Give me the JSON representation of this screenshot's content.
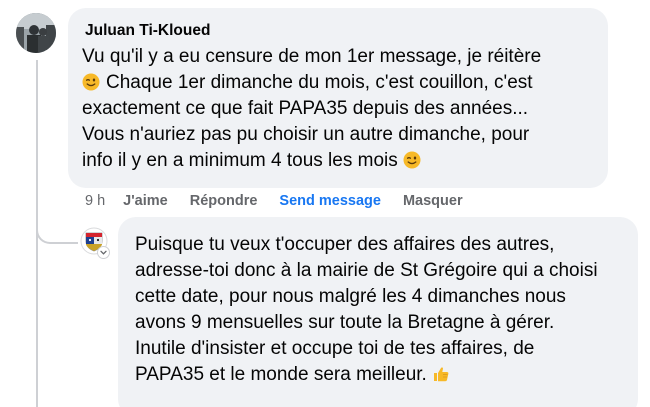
{
  "comment1": {
    "author": "Juluan Ti-Kloued",
    "lines": [
      "Vu qu'il y a eu censure de mon 1er message, je réitère",
      "Chaque 1er dimanche du mois, c'est couillon, c'est",
      "exactement ce que fait PAPA35 depuis des années...",
      "Vous n'auriez pas pu choisir un autre dimanche, pour",
      "info il y en a minimum 4 tous les mois"
    ],
    "emojis": [
      "winking-face-emoji",
      "winking-face-emoji"
    ],
    "actions": {
      "time": "9 h",
      "like": "J'aime",
      "reply": "Répondre",
      "send_message": "Send message",
      "hide": "Masquer"
    }
  },
  "reply1": {
    "lines": [
      "Puisque tu veux t'occuper des affaires des autres,",
      "adresse-toi donc à la mairie de St Grégoire qui a choisi",
      "cette date, pour nous malgré les 4 dimanches nous",
      "avons 9 mensuelles sur toute la Bretagne à gérer.",
      "Inutile d'insister et occupe toi de tes affaires, de",
      "PAPA35 et le monde sera meilleur."
    ],
    "emojis": [
      "thumbs-up-emoji"
    ]
  },
  "colors": {
    "bubble": "#f0f2f5",
    "text": "#050505",
    "muted": "#65676b",
    "link": "#1877f2",
    "emoji": "#f7b928"
  }
}
